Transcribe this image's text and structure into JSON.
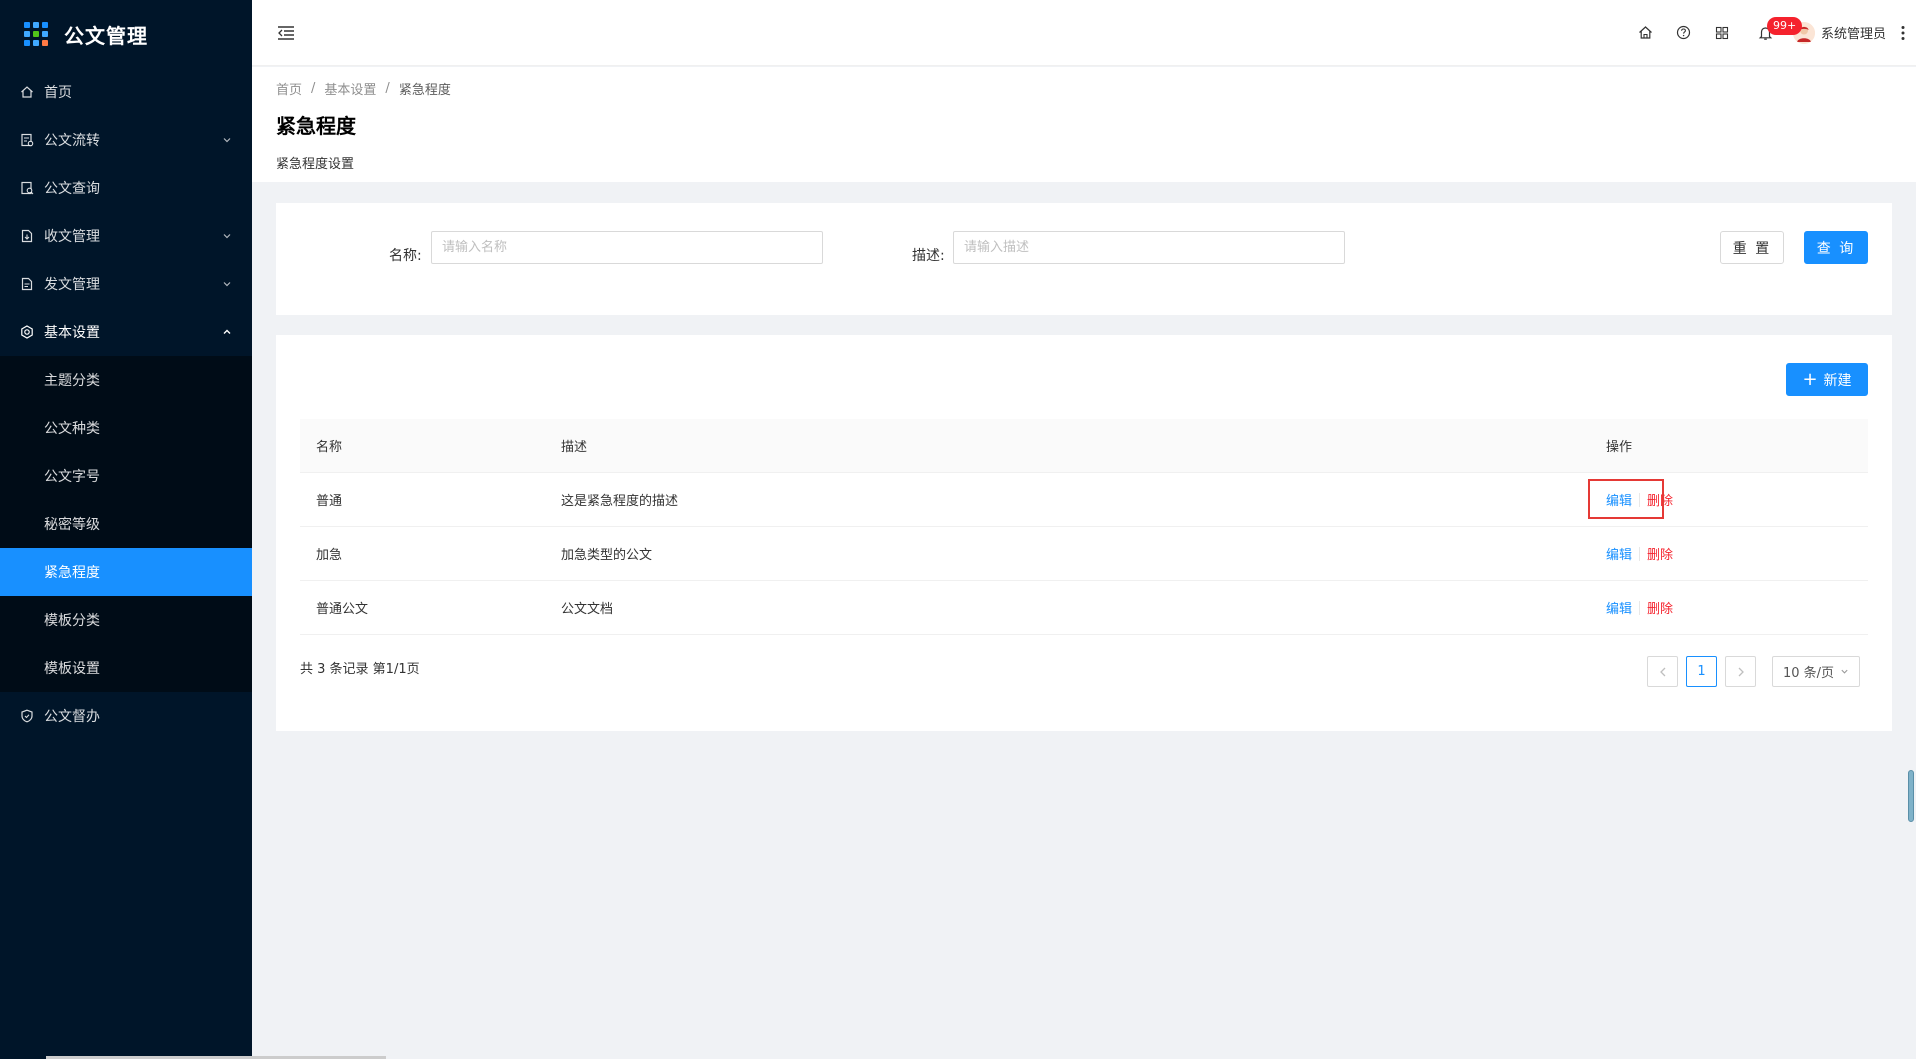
{
  "app": {
    "title": "公文管理"
  },
  "sidebar": {
    "items": [
      {
        "label": "首页",
        "icon": "home-icon",
        "has_children": false
      },
      {
        "label": "公文流转",
        "icon": "document-flow-icon",
        "has_children": true
      },
      {
        "label": "公文查询",
        "icon": "document-search-icon",
        "has_children": false
      },
      {
        "label": "收文管理",
        "icon": "inbox-document-icon",
        "has_children": true
      },
      {
        "label": "发文管理",
        "icon": "outbox-document-icon",
        "has_children": true
      },
      {
        "label": "基本设置",
        "icon": "settings-icon",
        "has_children": true,
        "open": true
      },
      {
        "label": "公文督办",
        "icon": "shield-icon",
        "has_children": false
      }
    ],
    "submenu": [
      {
        "label": "主题分类"
      },
      {
        "label": "公文种类"
      },
      {
        "label": "公文字号"
      },
      {
        "label": "秘密等级"
      },
      {
        "label": "紧急程度",
        "active": true
      },
      {
        "label": "模板分类"
      },
      {
        "label": "模板设置"
      }
    ]
  },
  "header": {
    "notification_badge": "99+",
    "user_name": "系统管理员"
  },
  "page_header": {
    "breadcrumb": [
      "首页",
      "基本设置",
      "紧急程度"
    ],
    "separator": "/",
    "title": "紧急程度",
    "description": "紧急程度设置"
  },
  "search": {
    "name_label": "名称:",
    "name_placeholder": "请输入名称",
    "name_value": "",
    "desc_label": "描述:",
    "desc_placeholder": "请输入描述",
    "desc_value": "",
    "reset_label": "重 置",
    "query_label": "查 询"
  },
  "table": {
    "new_label": "新建",
    "columns": [
      "名称",
      "描述",
      "操作"
    ],
    "rows": [
      {
        "name": "普通",
        "desc": "这是紧急程度的描述"
      },
      {
        "name": "加急",
        "desc": "加急类型的公文"
      },
      {
        "name": "普通公文",
        "desc": "公文文档"
      }
    ],
    "edit_label": "编辑",
    "delete_label": "删除"
  },
  "pagination": {
    "summary": "共 3 条记录 第1/1页",
    "current_page": "1",
    "page_size": "10 条/页"
  },
  "colors": {
    "sidebar_bg": "#001529",
    "primary": "#1890ff",
    "danger": "#f5222d",
    "highlight": "#e53935"
  }
}
